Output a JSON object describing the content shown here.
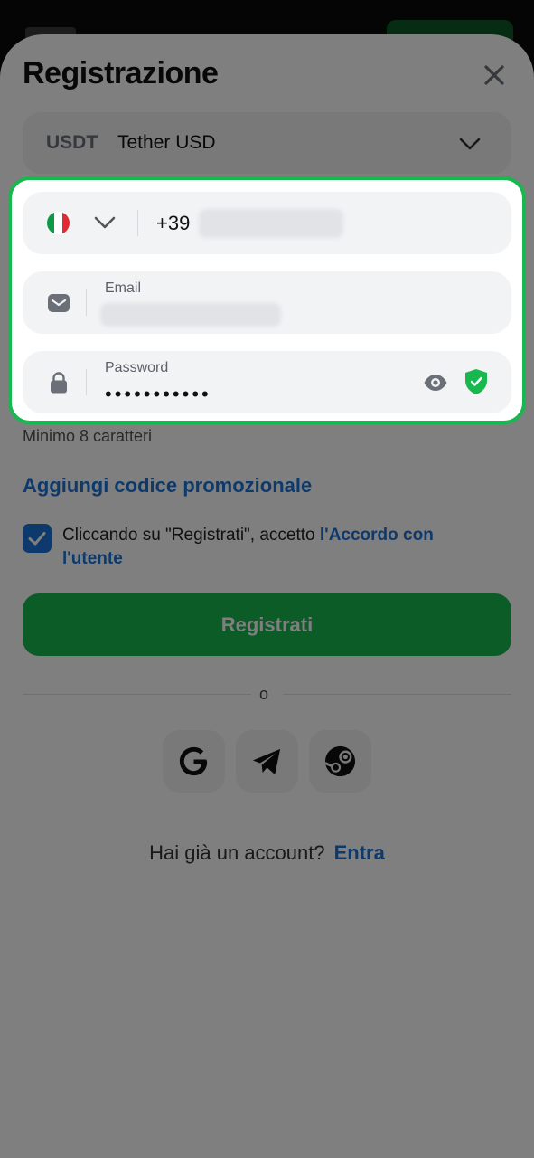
{
  "sheet": {
    "title": "Registrazione",
    "currency": {
      "code": "USDT",
      "name": "Tether USD"
    }
  },
  "form": {
    "phone": {
      "prefix": "+39",
      "country_icon": "italy-flag-icon"
    },
    "email": {
      "label": "Email"
    },
    "password": {
      "label": "Password",
      "masked_value": "•••••••••••",
      "hint": "Minimo 8 caratteri"
    }
  },
  "promo_link": "Aggiungi codice promozionale",
  "terms": {
    "text": "Cliccando su \"Registrati\", accetto ",
    "link": "l'Accordo con l'utente",
    "checked": true
  },
  "register_button": "Registrati",
  "divider_text": "o",
  "social": [
    {
      "icon": "google-icon"
    },
    {
      "icon": "telegram-icon"
    },
    {
      "icon": "steam-icon"
    }
  ],
  "account": {
    "question": "Hai già un account?",
    "login": "Entra"
  },
  "colors": {
    "primary_green": "#19b84f",
    "link_blue": "#1a73d9",
    "field_bg": "#f2f3f5"
  }
}
